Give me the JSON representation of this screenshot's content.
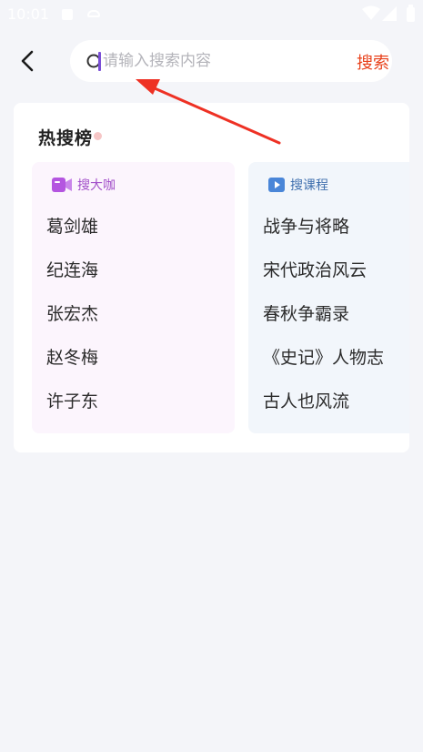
{
  "status_bar": {
    "time": "10:01",
    "icons": [
      "notification-icon",
      "debug-icon",
      "wifi-icon",
      "signal-icon",
      "battery-icon"
    ]
  },
  "header": {
    "back_icon": "chevron-left-icon",
    "search": {
      "placeholder": "请输入搜索内容",
      "value": ""
    },
    "search_label": "搜索"
  },
  "hot_list": {
    "title": "热搜榜",
    "panels": [
      {
        "title": "搜大咖",
        "icon": "video-camera-icon",
        "accent": "#a24fc9",
        "items": [
          "葛剑雄",
          "纪连海",
          "张宏杰",
          "赵冬梅",
          "许子东"
        ]
      },
      {
        "title": "搜课程",
        "icon": "play-icon",
        "accent": "#3f6fae",
        "items": [
          "战争与将略",
          "宋代政治风云",
          "春秋争霸录",
          "《史记》人物志",
          "古人也风流"
        ]
      }
    ]
  },
  "colors": {
    "background": "#f4f5f9",
    "search_accent": "#e8401a",
    "annotation_arrow": "#ee3124"
  }
}
